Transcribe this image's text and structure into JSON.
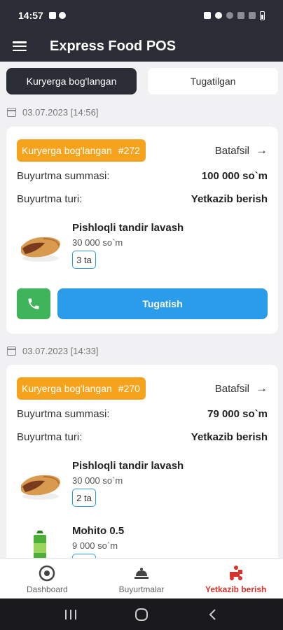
{
  "status_bar": {
    "time": "14:57"
  },
  "header": {
    "title": "Express Food POS"
  },
  "tabs": [
    {
      "label": "Kuryerga bog'langan",
      "active": true
    },
    {
      "label": "Tugatilgan",
      "active": false
    }
  ],
  "orders": [
    {
      "date": "03.07.2023 [14:56]",
      "status": "Kuryerga bog'langan",
      "number": "#272",
      "details_label": "Batafsil",
      "sum_label": "Buyurtma summasi:",
      "sum_value": "100 000 so`m",
      "type_label": "Buyurtma turi:",
      "type_value": "Yetkazib berish",
      "items": [
        {
          "name": "Pishloqli tandir lavash",
          "price": "30 000 so`m",
          "qty": "3 ta",
          "icon": "lavash-image"
        }
      ],
      "finish_label": "Tugatish"
    },
    {
      "date": "03.07.2023 [14:33]",
      "status": "Kuryerga bog'langan",
      "number": "#270",
      "details_label": "Batafsil",
      "sum_label": "Buyurtma summasi:",
      "sum_value": "79 000 so`m",
      "type_label": "Buyurtma turi:",
      "type_value": "Yetkazib berish",
      "items": [
        {
          "name": "Pishloqli tandir lavash",
          "price": "30 000 so`m",
          "qty": "2 ta",
          "icon": "lavash-image"
        },
        {
          "name": "Mohito 0.5",
          "price": "9 000 so`m",
          "qty": "",
          "icon": "mohito-image"
        }
      ]
    }
  ],
  "bottom_nav": [
    {
      "label": "Dashboard",
      "icon": "dashboard-icon",
      "active": false
    },
    {
      "label": "Buyurtmalar",
      "icon": "orders-icon",
      "active": false
    },
    {
      "label": "Yetkazib berish",
      "icon": "delivery-icon",
      "active": true
    }
  ],
  "colors": {
    "header": "#2a2c36",
    "badge": "#f5a31c",
    "primary": "#2b9cea",
    "call": "#3fb45a",
    "active_nav": "#d9322b"
  }
}
